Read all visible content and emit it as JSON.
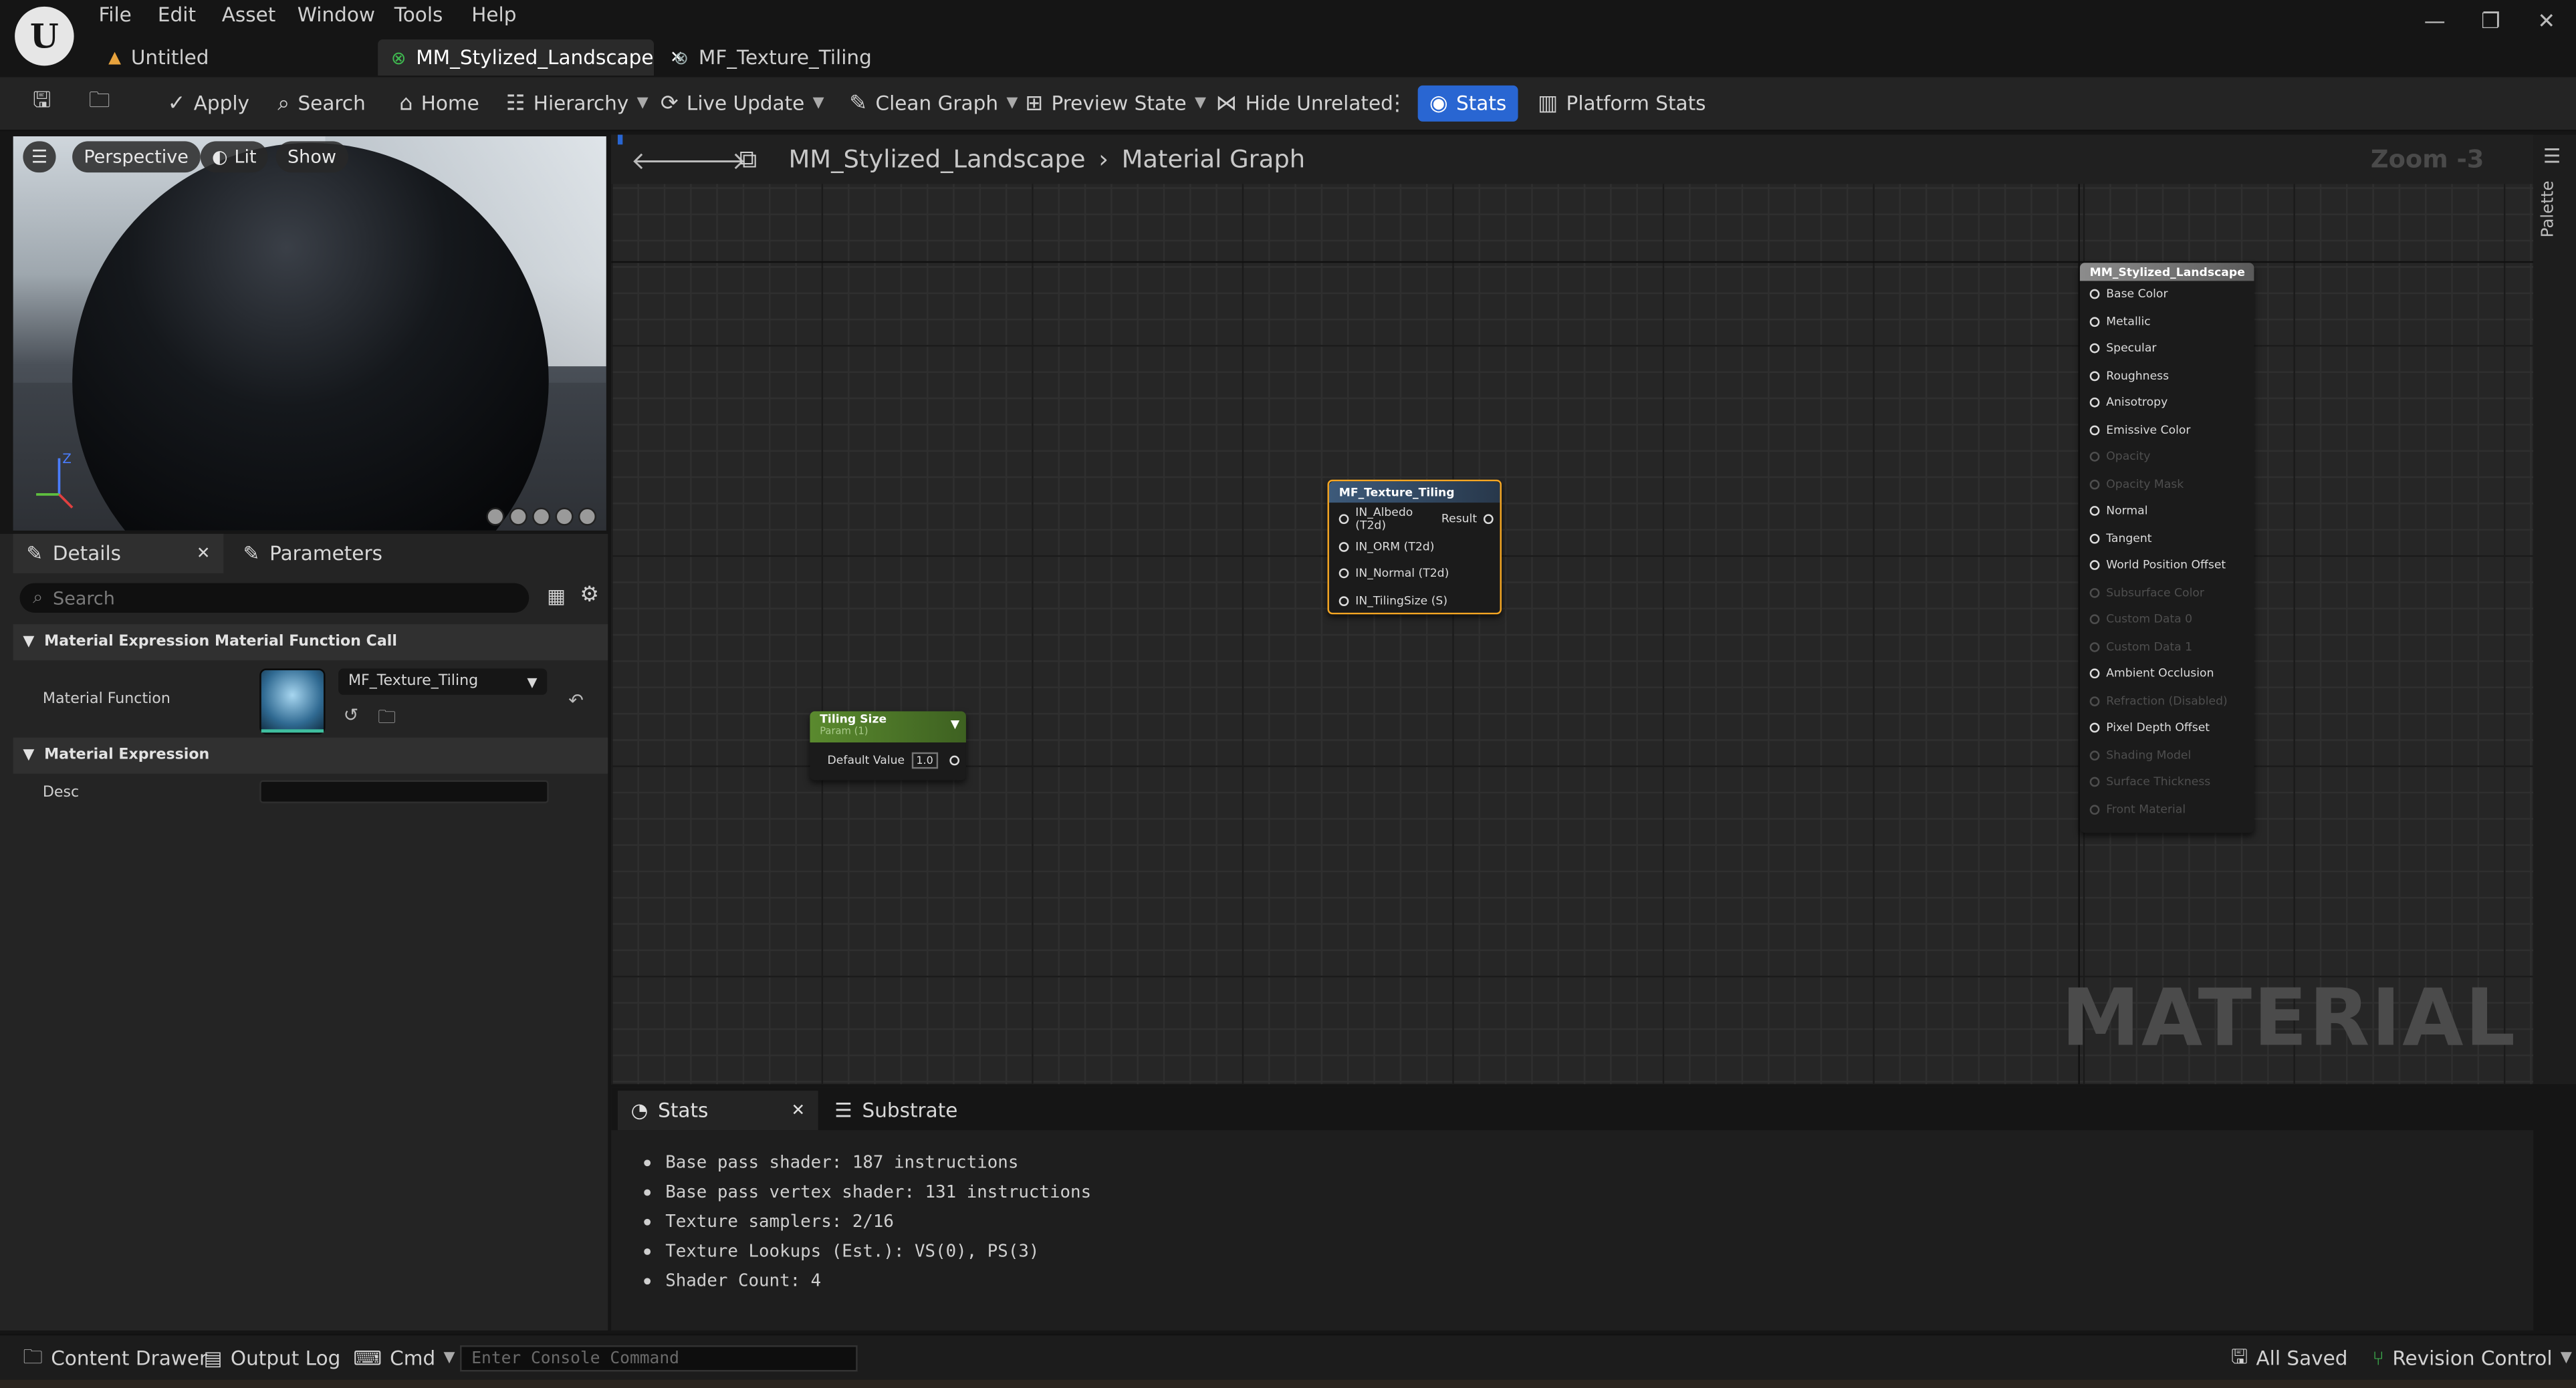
{
  "app": {
    "logo_letter": "U",
    "menu": [
      "File",
      "Edit",
      "Asset",
      "Window",
      "Tools",
      "Help"
    ],
    "tabs": [
      {
        "label": "Untitled"
      },
      {
        "label": "MM_Stylized_Landscape"
      },
      {
        "label": "MF_Texture_Tiling"
      }
    ],
    "window_controls": {
      "minimize": "—",
      "restore": "❐",
      "close": "✕"
    }
  },
  "toolbar": {
    "apply": "Apply",
    "search": "Search",
    "home": "Home",
    "hierarchy": "Hierarchy",
    "live_update": "Live Update",
    "clean_graph": "Clean Graph",
    "preview_state": "Preview State",
    "hide_unrelated": "Hide Unrelated",
    "stats": "Stats",
    "platform_stats": "Platform Stats"
  },
  "viewport": {
    "perspective": "Perspective",
    "lit": "Lit",
    "show": "Show",
    "axis_z": "Z"
  },
  "details": {
    "tab_details": "Details",
    "tab_parameters": "Parameters",
    "search_placeholder": "Search",
    "section1": "Material Expression Material Function Call",
    "material_function_label": "Material Function",
    "material_function_value": "MF_Texture_Tiling",
    "section2": "Material Expression",
    "desc_label": "Desc"
  },
  "graph": {
    "breadcrumb_root": "MM_Stylized_Landscape",
    "breadcrumb_leaf": "Material Graph",
    "zoom": "Zoom -3",
    "palette": "Palette",
    "watermark": "MATERIAL",
    "function_node": {
      "title": "MF_Texture_Tiling",
      "inputs": [
        "IN_Albedo (T2d)",
        "IN_ORM (T2d)",
        "IN_Normal (T2d)",
        "IN_TilingSize (S)"
      ],
      "output": "Result"
    },
    "param_node": {
      "title": "Tiling Size",
      "subtitle": "Param (1)",
      "default_label": "Default Value",
      "default_value": "1.0"
    },
    "material_node": {
      "title": "MM_Stylized_Landscape",
      "pins": [
        {
          "label": "Base Color",
          "active": true
        },
        {
          "label": "Metallic",
          "active": true
        },
        {
          "label": "Specular",
          "active": true
        },
        {
          "label": "Roughness",
          "active": true
        },
        {
          "label": "Anisotropy",
          "active": true
        },
        {
          "label": "Emissive Color",
          "active": true
        },
        {
          "label": "Opacity",
          "active": false
        },
        {
          "label": "Opacity Mask",
          "active": false
        },
        {
          "label": "Normal",
          "active": true
        },
        {
          "label": "Tangent",
          "active": true
        },
        {
          "label": "World Position Offset",
          "active": true
        },
        {
          "label": "Subsurface Color",
          "active": false
        },
        {
          "label": "Custom Data 0",
          "active": false
        },
        {
          "label": "Custom Data 1",
          "active": false
        },
        {
          "label": "Ambient Occlusion",
          "active": true
        },
        {
          "label": "Refraction (Disabled)",
          "active": false
        },
        {
          "label": "Pixel Depth Offset",
          "active": true
        },
        {
          "label": "Shading Model",
          "active": false
        },
        {
          "label": "Surface Thickness",
          "active": false
        },
        {
          "label": "Front Material",
          "active": false
        }
      ]
    }
  },
  "stats": {
    "tab_stats": "Stats",
    "tab_substrate": "Substrate",
    "lines": [
      "Base pass shader: 187 instructions",
      "Base pass vertex shader: 131 instructions",
      "Texture samplers: 2/16",
      "Texture Lookups (Est.): VS(0), PS(3)",
      "Shader Count: 4"
    ]
  },
  "statusbar": {
    "content_drawer": "Content Drawer",
    "output_log": "Output Log",
    "cmd": "Cmd",
    "console_placeholder": "Enter Console Command",
    "all_saved": "All Saved",
    "revision_control": "Revision Control"
  },
  "colors": {
    "accent": "#2966d2",
    "node_selected": "#f5a623",
    "param_green": "#5a8a2e"
  }
}
